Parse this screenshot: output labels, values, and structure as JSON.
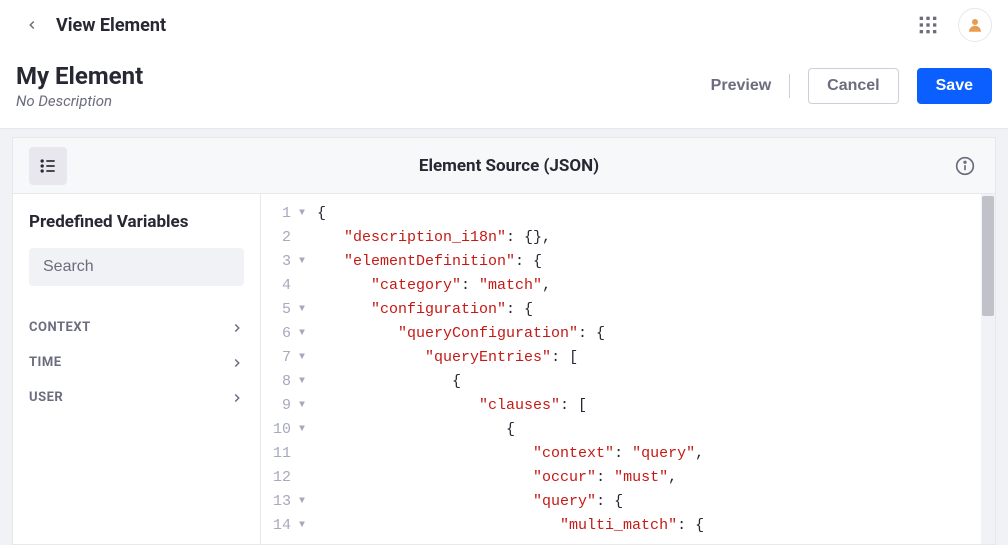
{
  "topbar": {
    "title": "View Element"
  },
  "subheader": {
    "title": "My Element",
    "description": "No Description",
    "preview": "Preview",
    "cancel": "Cancel",
    "save": "Save"
  },
  "panel": {
    "title": "Element Source (JSON)"
  },
  "sidebar": {
    "title": "Predefined Variables",
    "search_placeholder": "Search",
    "items": [
      {
        "label": "CONTEXT"
      },
      {
        "label": "TIME"
      },
      {
        "label": "USER"
      }
    ]
  },
  "editor": {
    "lines": [
      {
        "n": 1,
        "fold": true,
        "indent": 0,
        "segs": [
          {
            "t": "{",
            "c": "pun"
          }
        ]
      },
      {
        "n": 2,
        "fold": false,
        "indent": 1,
        "segs": [
          {
            "t": "\"description_i18n\"",
            "c": "str"
          },
          {
            "t": ": {},",
            "c": "pun"
          }
        ]
      },
      {
        "n": 3,
        "fold": true,
        "indent": 1,
        "segs": [
          {
            "t": "\"elementDefinition\"",
            "c": "str"
          },
          {
            "t": ": {",
            "c": "pun"
          }
        ]
      },
      {
        "n": 4,
        "fold": false,
        "indent": 2,
        "segs": [
          {
            "t": "\"category\"",
            "c": "str"
          },
          {
            "t": ": ",
            "c": "pun"
          },
          {
            "t": "\"match\"",
            "c": "str"
          },
          {
            "t": ",",
            "c": "pun"
          }
        ]
      },
      {
        "n": 5,
        "fold": true,
        "indent": 2,
        "segs": [
          {
            "t": "\"configuration\"",
            "c": "str"
          },
          {
            "t": ": {",
            "c": "pun"
          }
        ]
      },
      {
        "n": 6,
        "fold": true,
        "indent": 3,
        "segs": [
          {
            "t": "\"queryConfiguration\"",
            "c": "str"
          },
          {
            "t": ": {",
            "c": "pun"
          }
        ]
      },
      {
        "n": 7,
        "fold": true,
        "indent": 4,
        "segs": [
          {
            "t": "\"queryEntries\"",
            "c": "str"
          },
          {
            "t": ": [",
            "c": "pun"
          }
        ]
      },
      {
        "n": 8,
        "fold": true,
        "indent": 5,
        "segs": [
          {
            "t": "{",
            "c": "pun"
          }
        ]
      },
      {
        "n": 9,
        "fold": true,
        "indent": 6,
        "segs": [
          {
            "t": "\"clauses\"",
            "c": "str"
          },
          {
            "t": ": [",
            "c": "pun"
          }
        ]
      },
      {
        "n": 10,
        "fold": true,
        "indent": 7,
        "segs": [
          {
            "t": "{",
            "c": "pun"
          }
        ]
      },
      {
        "n": 11,
        "fold": false,
        "indent": 8,
        "segs": [
          {
            "t": "\"context\"",
            "c": "str"
          },
          {
            "t": ": ",
            "c": "pun"
          },
          {
            "t": "\"query\"",
            "c": "str"
          },
          {
            "t": ",",
            "c": "pun"
          }
        ]
      },
      {
        "n": 12,
        "fold": false,
        "indent": 8,
        "segs": [
          {
            "t": "\"occur\"",
            "c": "str"
          },
          {
            "t": ": ",
            "c": "pun"
          },
          {
            "t": "\"must\"",
            "c": "str"
          },
          {
            "t": ",",
            "c": "pun"
          }
        ]
      },
      {
        "n": 13,
        "fold": true,
        "indent": 8,
        "segs": [
          {
            "t": "\"query\"",
            "c": "str"
          },
          {
            "t": ": {",
            "c": "pun"
          }
        ]
      },
      {
        "n": 14,
        "fold": true,
        "indent": 9,
        "segs": [
          {
            "t": "\"multi_match\"",
            "c": "str"
          },
          {
            "t": ": {",
            "c": "pun"
          }
        ]
      }
    ]
  }
}
